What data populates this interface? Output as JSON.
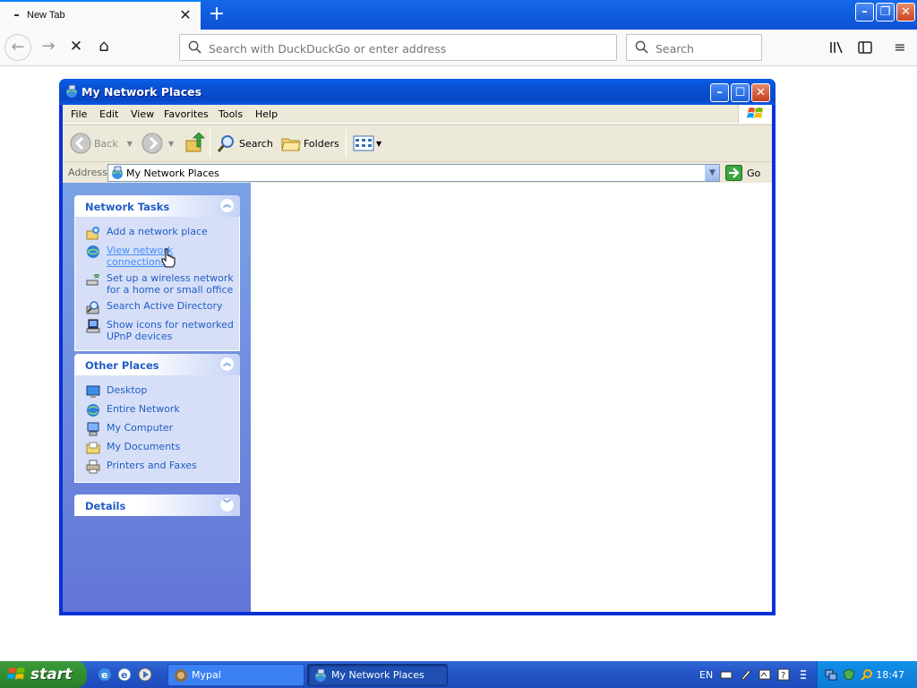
{
  "browser": {
    "tab_title": "New Tab",
    "url_placeholder": "Search with DuckDuckGo or enter address",
    "search_placeholder": "Search"
  },
  "window": {
    "title": "My Network Places",
    "menu": [
      "File",
      "Edit",
      "View",
      "Favorites",
      "Tools",
      "Help"
    ],
    "toolbar": {
      "back": "Back",
      "search": "Search",
      "folders": "Folders"
    },
    "address_label": "Address",
    "address_value": "My Network Places",
    "go_label": "Go"
  },
  "taskpane": {
    "network_tasks": {
      "title": "Network Tasks",
      "items": [
        {
          "label": "Add a network place",
          "icon": "add-network-place-icon"
        },
        {
          "label": "View network connections",
          "icon": "network-connections-icon"
        },
        {
          "label": "Set up a wireless network for a home or small office",
          "icon": "wireless-network-icon"
        },
        {
          "label": "Search Active Directory",
          "icon": "search-directory-icon"
        },
        {
          "label": "Show icons for networked UPnP devices",
          "icon": "upnp-device-icon"
        }
      ]
    },
    "other_places": {
      "title": "Other Places",
      "items": [
        {
          "label": "Desktop",
          "icon": "desktop-icon"
        },
        {
          "label": "Entire Network",
          "icon": "entire-network-icon"
        },
        {
          "label": "My Computer",
          "icon": "my-computer-icon"
        },
        {
          "label": "My Documents",
          "icon": "my-documents-icon"
        },
        {
          "label": "Printers and Faxes",
          "icon": "printers-faxes-icon"
        }
      ]
    },
    "details": {
      "title": "Details"
    }
  },
  "taskbar": {
    "start_label": "start",
    "tasks": [
      "Mypal",
      "My Network Places"
    ],
    "language": "EN",
    "clock": "18:47"
  },
  "colors": {
    "xp_title_blue": "#0a4fd0",
    "taskpane_link": "#215dc6",
    "start_green": "#2f8f2f"
  }
}
